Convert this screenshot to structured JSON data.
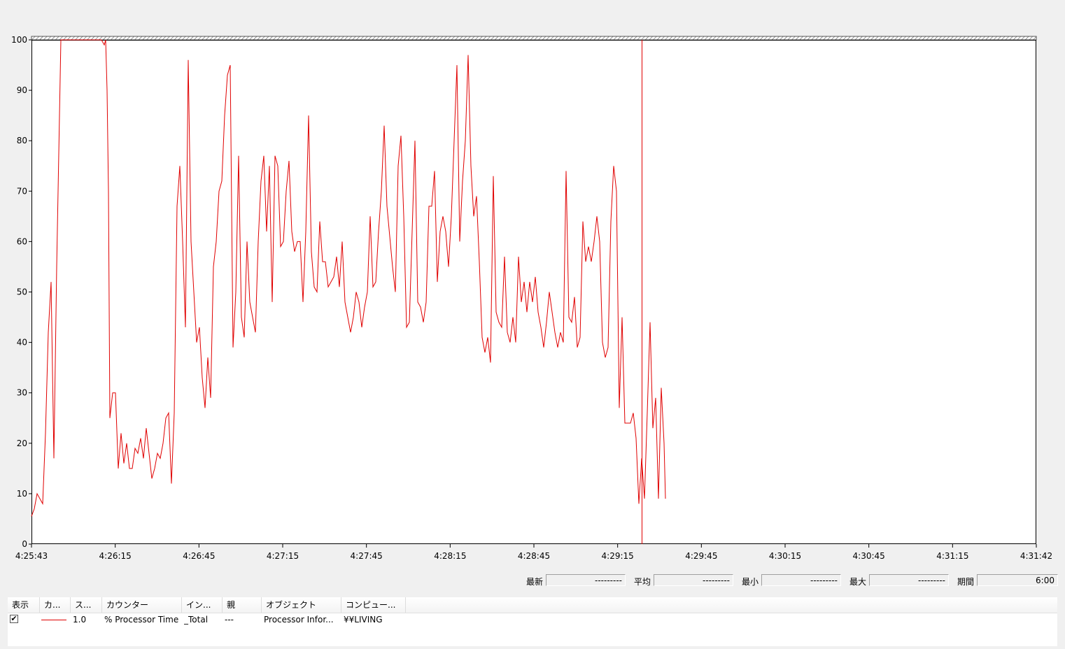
{
  "chart_data": {
    "type": "line",
    "title": "",
    "xlabel": "",
    "ylabel": "",
    "ylim": [
      0,
      100
    ],
    "y_ticks": [
      0,
      10,
      20,
      30,
      40,
      50,
      60,
      70,
      80,
      90,
      100
    ],
    "x_ticks": [
      "4:25:43",
      "4:26:15",
      "4:26:45",
      "4:27:15",
      "4:27:45",
      "4:28:15",
      "4:28:45",
      "4:29:15",
      "4:29:45",
      "4:30:15",
      "4:30:45",
      "4:31:15",
      "4:31:42"
    ],
    "grid": false,
    "line_color": "#e00000",
    "current_time_marker_seconds": 218,
    "series": [
      {
        "name": "% Processor Time",
        "points": [
          [
            0,
            5.5
          ],
          [
            1,
            7
          ],
          [
            2,
            10
          ],
          [
            4,
            8
          ],
          [
            5,
            22
          ],
          [
            6,
            42
          ],
          [
            7,
            52
          ],
          [
            8,
            17
          ],
          [
            9,
            55
          ],
          [
            10,
            85
          ],
          [
            10.5,
            100
          ],
          [
            25,
            100
          ],
          [
            26,
            99
          ],
          [
            26.5,
            100
          ],
          [
            27,
            90
          ],
          [
            27.5,
            70
          ],
          [
            28,
            25
          ],
          [
            29,
            30
          ],
          [
            30,
            30
          ],
          [
            31,
            15
          ],
          [
            32,
            22
          ],
          [
            33,
            16
          ],
          [
            34,
            20
          ],
          [
            35,
            15
          ],
          [
            36,
            15
          ],
          [
            37,
            19
          ],
          [
            38,
            18
          ],
          [
            39,
            21
          ],
          [
            40,
            17
          ],
          [
            41,
            23
          ],
          [
            42,
            18
          ],
          [
            43,
            13
          ],
          [
            44,
            15
          ],
          [
            45,
            18
          ],
          [
            46,
            17
          ],
          [
            47,
            20
          ],
          [
            48,
            25
          ],
          [
            49,
            26
          ],
          [
            50,
            12
          ],
          [
            51,
            26
          ],
          [
            52,
            67
          ],
          [
            53,
            75
          ],
          [
            54,
            60
          ],
          [
            55,
            43
          ],
          [
            56,
            96
          ],
          [
            57,
            60
          ],
          [
            58,
            50
          ],
          [
            59,
            40
          ],
          [
            60,
            43
          ],
          [
            61,
            33
          ],
          [
            62,
            27
          ],
          [
            63,
            37
          ],
          [
            64,
            29
          ],
          [
            65,
            55
          ],
          [
            66,
            60
          ],
          [
            67,
            70
          ],
          [
            68,
            72
          ],
          [
            69,
            85
          ],
          [
            70,
            93
          ],
          [
            71,
            95
          ],
          [
            72,
            39
          ],
          [
            73,
            50
          ],
          [
            74,
            77
          ],
          [
            75,
            45
          ],
          [
            76,
            41
          ],
          [
            77,
            60
          ],
          [
            78,
            48
          ],
          [
            79,
            45
          ],
          [
            80,
            42
          ],
          [
            81,
            60
          ],
          [
            82,
            72
          ],
          [
            83,
            77
          ],
          [
            84,
            62
          ],
          [
            85,
            75
          ],
          [
            86,
            48
          ],
          [
            87,
            77
          ],
          [
            88,
            75
          ],
          [
            89,
            59
          ],
          [
            90,
            60
          ],
          [
            91,
            70
          ],
          [
            92,
            76
          ],
          [
            93,
            62
          ],
          [
            94,
            58
          ],
          [
            95,
            60
          ],
          [
            96,
            60
          ],
          [
            97,
            48
          ],
          [
            98,
            62
          ],
          [
            99,
            85
          ],
          [
            100,
            58
          ],
          [
            101,
            51
          ],
          [
            102,
            50
          ],
          [
            103,
            64
          ],
          [
            104,
            56
          ],
          [
            105,
            56
          ],
          [
            106,
            51
          ],
          [
            107,
            52
          ],
          [
            108,
            53
          ],
          [
            109,
            57
          ],
          [
            110,
            51
          ],
          [
            111,
            60
          ],
          [
            112,
            48
          ],
          [
            113,
            45
          ],
          [
            114,
            42
          ],
          [
            115,
            45
          ],
          [
            116,
            50
          ],
          [
            117,
            48
          ],
          [
            118,
            43
          ],
          [
            119,
            47
          ],
          [
            120,
            50
          ],
          [
            121,
            65
          ],
          [
            122,
            51
          ],
          [
            123,
            52
          ],
          [
            124,
            62
          ],
          [
            125,
            70
          ],
          [
            126,
            83
          ],
          [
            127,
            67
          ],
          [
            128,
            61
          ],
          [
            129,
            55
          ],
          [
            130,
            50
          ],
          [
            131,
            75
          ],
          [
            132,
            81
          ],
          [
            133,
            65
          ],
          [
            134,
            43
          ],
          [
            135,
            44
          ],
          [
            136,
            62
          ],
          [
            137,
            80
          ],
          [
            138,
            48
          ],
          [
            139,
            47
          ],
          [
            140,
            44
          ],
          [
            141,
            48
          ],
          [
            142,
            67
          ],
          [
            143,
            67
          ],
          [
            144,
            74
          ],
          [
            145,
            52
          ],
          [
            146,
            62
          ],
          [
            147,
            65
          ],
          [
            148,
            62
          ],
          [
            149,
            55
          ],
          [
            150,
            65
          ],
          [
            151,
            80
          ],
          [
            152,
            95
          ],
          [
            153,
            60
          ],
          [
            154,
            72
          ],
          [
            155,
            80
          ],
          [
            156,
            97
          ],
          [
            157,
            75
          ],
          [
            158,
            65
          ],
          [
            159,
            69
          ],
          [
            160,
            56
          ],
          [
            161,
            41
          ],
          [
            162,
            38
          ],
          [
            163,
            41
          ],
          [
            164,
            36
          ],
          [
            165,
            73
          ],
          [
            166,
            46
          ],
          [
            167,
            44
          ],
          [
            168,
            43
          ],
          [
            169,
            57
          ],
          [
            170,
            42
          ],
          [
            171,
            40
          ],
          [
            172,
            45
          ],
          [
            173,
            40
          ],
          [
            174,
            57
          ],
          [
            175,
            48
          ],
          [
            176,
            52
          ],
          [
            177,
            46
          ],
          [
            178,
            52
          ],
          [
            179,
            48
          ],
          [
            180,
            53
          ],
          [
            181,
            46
          ],
          [
            182,
            43
          ],
          [
            183,
            39
          ],
          [
            184,
            44
          ],
          [
            185,
            50
          ],
          [
            186,
            46
          ],
          [
            187,
            42
          ],
          [
            188,
            39
          ],
          [
            189,
            42
          ],
          [
            190,
            40
          ],
          [
            191,
            74
          ],
          [
            192,
            45
          ],
          [
            193,
            44
          ],
          [
            194,
            49
          ],
          [
            195,
            39
          ],
          [
            196,
            41
          ],
          [
            197,
            64
          ],
          [
            198,
            56
          ],
          [
            199,
            59
          ],
          [
            200,
            56
          ],
          [
            201,
            60
          ],
          [
            202,
            65
          ],
          [
            203,
            60
          ],
          [
            204,
            40
          ],
          [
            205,
            37
          ],
          [
            206,
            39
          ],
          [
            207,
            64
          ],
          [
            208,
            75
          ],
          [
            209,
            70
          ],
          [
            210,
            27
          ],
          [
            211,
            45
          ],
          [
            212,
            24
          ],
          [
            213,
            24
          ],
          [
            214,
            24
          ],
          [
            215,
            26
          ],
          [
            216,
            21
          ],
          [
            217,
            8
          ],
          [
            218,
            17
          ],
          [
            219,
            9
          ],
          [
            220,
            26
          ],
          [
            221,
            44
          ],
          [
            222,
            23
          ],
          [
            223,
            29
          ],
          [
            224,
            9
          ],
          [
            225,
            31
          ],
          [
            226,
            20
          ],
          [
            226.5,
            9
          ]
        ]
      }
    ]
  },
  "stats": {
    "latest_label": "最新",
    "latest_value": "---------",
    "average_label": "平均",
    "average_value": "---------",
    "minimum_label": "最小",
    "minimum_value": "---------",
    "maximum_label": "最大",
    "maximum_value": "---------",
    "duration_label": "期間",
    "duration_value": "6:00"
  },
  "counter_list": {
    "headers": {
      "show": "表示",
      "color": "カ...",
      "scale": "ス...",
      "counter": "カウンター",
      "instance": "イン...",
      "parent": "親",
      "object": "オブジェクト",
      "computer": "コンピュー..."
    },
    "row": {
      "checked": "✔",
      "scale": "1.0",
      "counter": "% Processor Time",
      "instance": "_Total",
      "parent": "---",
      "object": "Processor Infor...",
      "computer": "¥¥LIVING"
    }
  }
}
